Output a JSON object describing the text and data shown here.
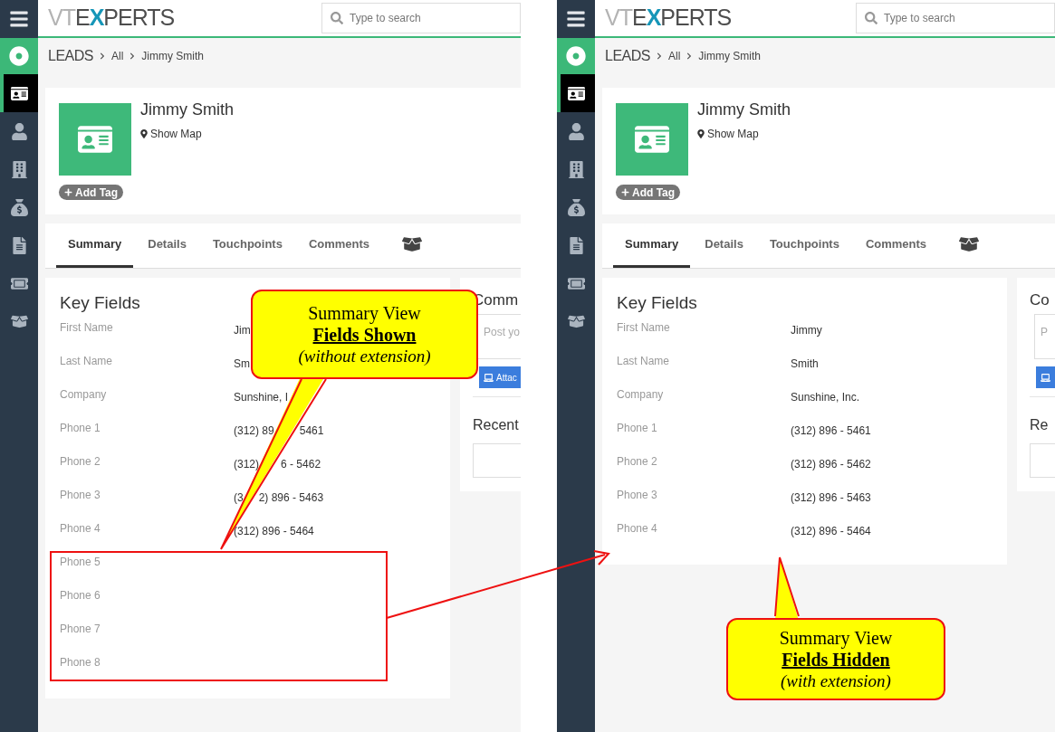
{
  "panels": [
    {
      "logo": [
        {
          "text": "VT",
          "color": "#b3b3b3"
        },
        {
          "text": "E",
          "color": "#4d4d4d"
        },
        {
          "text": "X",
          "color": "#1696b8"
        },
        {
          "text": "PERTS",
          "color": "#4d4d4d"
        }
      ],
      "search": {
        "placeholder": "Type to search"
      },
      "sidebar": [
        {
          "selected": true
        },
        {
          "selected": false
        },
        {
          "selected": false
        },
        {
          "selected": false
        },
        {
          "selected": false
        },
        {
          "selected": false
        },
        {
          "selected": false
        }
      ],
      "breadcrumb": [
        "LEADS",
        "All",
        "Jimmy Smith"
      ],
      "record": {
        "name": "Jimmy Smith",
        "map_link": "Show Map",
        "tag_button": "Add Tag"
      },
      "tabs": [
        {
          "kind": "text",
          "label": "Summary",
          "selected": true
        },
        {
          "kind": "text",
          "label": "Details",
          "selected": false
        },
        {
          "kind": "text",
          "label": "Touchpoints",
          "selected": false
        },
        {
          "kind": "text",
          "label": "Comments",
          "selected": false
        },
        {
          "kind": "icon",
          "selected": false
        }
      ],
      "key_fields": {
        "title": "Key Fields",
        "rows": [
          {
            "label": "First Name",
            "value": [
              "Jim"
            ]
          },
          {
            "label": "Last Name",
            "value": [
              "Sm"
            ]
          },
          {
            "label": "Company",
            "value": [
              "Sunshine, I"
            ]
          },
          {
            "label": "Phone 1",
            "value": [
              "(312) 89",
              "5461"
            ]
          },
          {
            "label": "Phone 2",
            "value": [
              "(312)",
              "6 - 5462"
            ]
          },
          {
            "label": "Phone 3",
            "value": [
              "(3",
              "2) 896 - 5463"
            ]
          },
          {
            "label": "Phone 4",
            "value": [
              "(312) 896 - 5464"
            ]
          },
          {
            "label": "Phone 5"
          },
          {
            "label": "Phone 6"
          },
          {
            "label": "Phone 7"
          },
          {
            "label": "Phone 8"
          }
        ]
      },
      "side_card": {
        "title": "Comm",
        "placeholder": "Post yo",
        "button": "Attac",
        "recent_title": "Recent"
      }
    },
    {
      "logo": [
        {
          "text": "VT",
          "color": "#b3b3b3"
        },
        {
          "text": "E",
          "color": "#4d4d4d"
        },
        {
          "text": "X",
          "color": "#1696b8"
        },
        {
          "text": "PERTS",
          "color": "#4d4d4d"
        }
      ],
      "search": {
        "placeholder": "Type to search"
      },
      "sidebar": [
        {
          "selected": true
        },
        {
          "selected": false
        },
        {
          "selected": false
        },
        {
          "selected": false
        },
        {
          "selected": false
        },
        {
          "selected": false
        },
        {
          "selected": false
        }
      ],
      "breadcrumb": [
        "LEADS",
        "All",
        "Jimmy Smith"
      ],
      "record": {
        "name": "Jimmy Smith",
        "map_link": "Show Map",
        "tag_button": "Add Tag"
      },
      "tabs": [
        {
          "kind": "text",
          "label": "Summary",
          "selected": true
        },
        {
          "kind": "text",
          "label": "Details",
          "selected": false
        },
        {
          "kind": "text",
          "label": "Touchpoints",
          "selected": false
        },
        {
          "kind": "text",
          "label": "Comments",
          "selected": false
        },
        {
          "kind": "icon",
          "selected": false
        }
      ],
      "key_fields": {
        "title": "Key Fields",
        "rows": [
          {
            "label": "First Name",
            "value": [
              "Jimmy"
            ]
          },
          {
            "label": "Last Name",
            "value": [
              "Smith"
            ]
          },
          {
            "label": "Company",
            "value": [
              "Sunshine, Inc."
            ]
          },
          {
            "label": "Phone 1",
            "value": [
              "(312) 896 - 5461"
            ]
          },
          {
            "label": "Phone 2",
            "value": [
              "(312) 896 - 5462"
            ]
          },
          {
            "label": "Phone 3",
            "value": [
              "(312) 896 - 5463"
            ]
          },
          {
            "label": "Phone 4",
            "value": [
              "(312) 896 - 5464"
            ]
          }
        ]
      },
      "side_card": {
        "title": "Co",
        "placeholder": "P",
        "recent_title": "Re"
      }
    }
  ],
  "callouts": [
    {
      "title": "Summary View",
      "emphasis": "Fields Shown",
      "note": "(without extension)"
    },
    {
      "title": "Summary View",
      "emphasis": "Fields Hidden",
      "note": "(with extension)"
    }
  ]
}
